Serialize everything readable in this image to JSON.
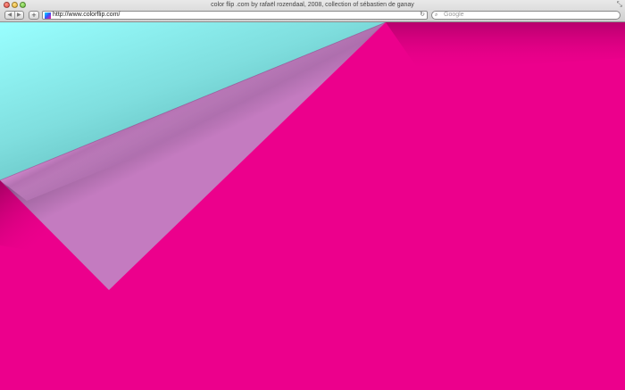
{
  "window": {
    "title": "color flip .com by rafaël rozendaal, 2008, collection of sébastien de ganay"
  },
  "toolbar": {
    "back_glyph": "◀",
    "forward_glyph": "▶",
    "add_glyph": "+",
    "reload_glyph": "↻",
    "search_glyph": "🔍",
    "resize_glyph": "⤡"
  },
  "address": {
    "url": "http://www.colorflip.com/"
  },
  "search": {
    "placeholder": "Google"
  },
  "colors": {
    "background": "#ec008c",
    "revealed": "#99ffff",
    "flap": "#c47bc0"
  }
}
